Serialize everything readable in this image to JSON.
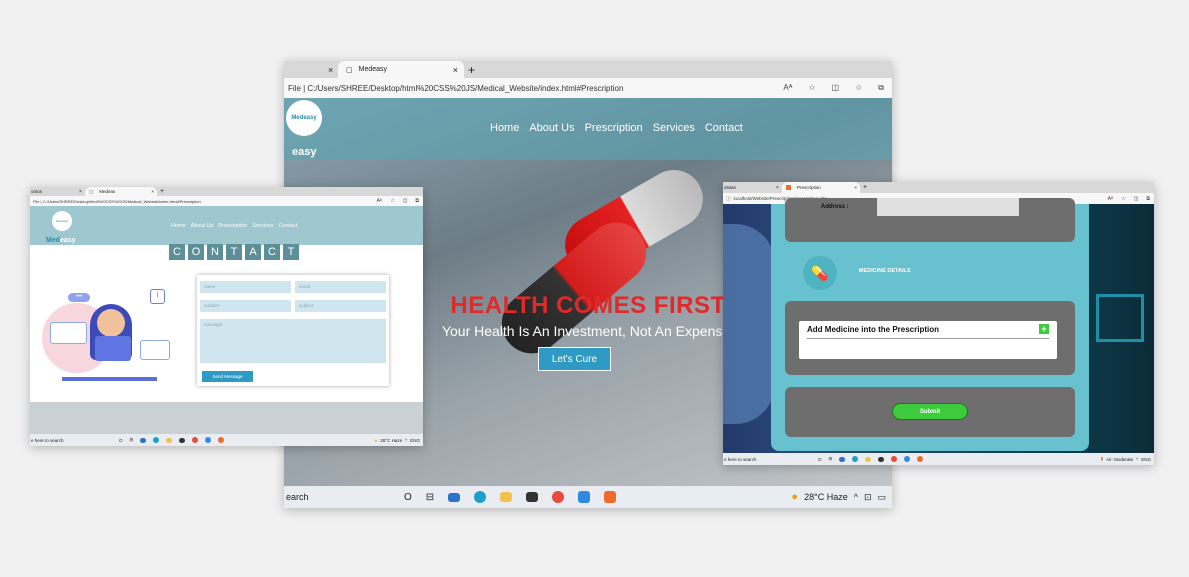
{
  "main": {
    "tabs": [
      "×",
      "Medeasy",
      "×",
      "+"
    ],
    "address": "File  |  C:/Users/SHREE/Desktop/html%20CSS%20JS/Medical_Website/index.html#Prescription",
    "logo_text": "Medeasy",
    "brand": "easy",
    "nav": [
      "Home",
      "About Us",
      "Prescription",
      "Services",
      "Contact"
    ],
    "headline": "HEALTH COMES FIRST",
    "tagline": "Your Health Is An Investment, Not An Expense.",
    "cta": "Let's Cure",
    "taskbar": {
      "search": "earch",
      "weather": "28°C  Haze"
    }
  },
  "contact": {
    "tabs": [
      "ontos",
      "×",
      "Medeas",
      "×",
      "+"
    ],
    "address": "File  |  C:/Users/SHREE/Desktop/html%20CSS%20JS/Medical_Website/index.html#Prescription",
    "logo_text": "Medeasy",
    "brand_prefix": "Med",
    "brand_suffix": "easy",
    "nav": [
      "Home",
      "About Us",
      "Prescription",
      "Services",
      "Contact"
    ],
    "title_letters": [
      "C",
      "O",
      "N",
      "T",
      "A",
      "C",
      "T"
    ],
    "form": {
      "name": "name",
      "email": "email",
      "number": "number",
      "subject": "subject",
      "message": "message",
      "send": "Send Message"
    },
    "taskbar": {
      "search": "e here to search",
      "weather": "28°C  Haze",
      "lang": "ENG"
    }
  },
  "prescription": {
    "tabs": [
      "ebsite",
      "×",
      "Prescription",
      "×",
      "+"
    ],
    "address": "localhost/Website/Prescription/prescription.php",
    "address_label": "Address :",
    "medicine_details": "MEDICINE DETAILS",
    "add_medicine": "Add Medicine into the Prescription",
    "add_icon": "+",
    "submit": "Submit",
    "taskbar": {
      "search": "e here to search",
      "status": "Air: Moderate",
      "lang": "ENG"
    }
  },
  "colors": {
    "teal": "#67c1cf",
    "cta": "#2f9bc4",
    "red": "#e02a2a",
    "green": "#3dcb3d"
  }
}
